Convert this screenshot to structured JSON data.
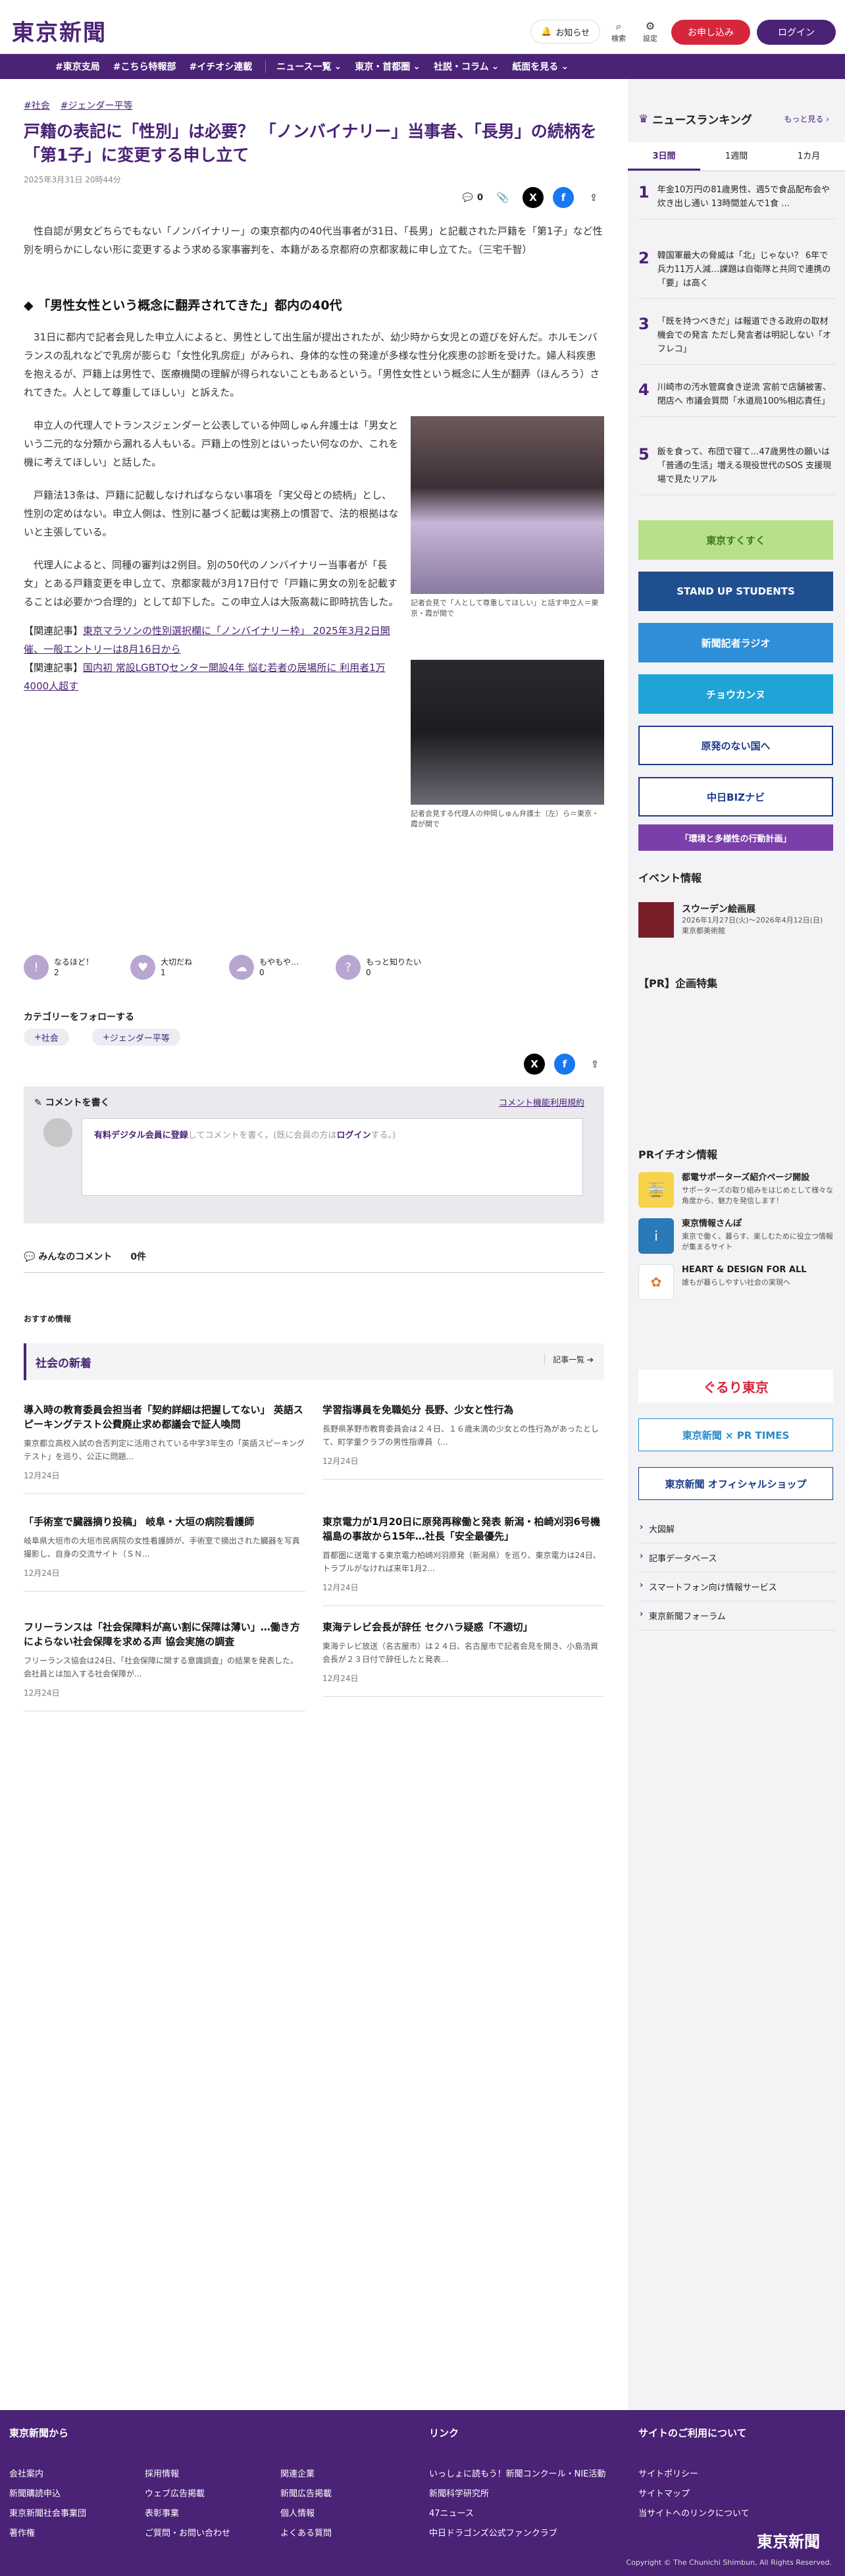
{
  "header": {
    "logo": "東京新聞",
    "notice": "お知らせ",
    "search": "検索",
    "settings": "設定",
    "apply": "お申し込み",
    "login": "ログイン"
  },
  "nav": {
    "tags": [
      "#東京支局",
      "#こちら特報部",
      "#イチオシ連載"
    ],
    "menus": [
      "ニュース一覧",
      "東京・首都圏",
      "社説・コラム",
      "紙面を見る"
    ]
  },
  "article": {
    "tags": [
      "社会",
      "ジェンダー平等"
    ],
    "title": "戸籍の表記に「性別」は必要？ 「ノンバイナリー」当事者、「長男」の続柄を「第1子」に変更する申し立て",
    "date": "2025年3月31日 20時44分",
    "comment_count": "0",
    "lead": "性自認が男女どちらでもない「ノンバイナリー」の東京都内の40代当事者が31日、「長男」と記載された戸籍を「第1子」など性別を明らかにしない形に変更するよう求める家事審判を、本籍がある京都府の京都家裁に申し立てた。（三宅千智）",
    "h2": "「男性女性という概念に翻弄されてきた」都内の40代",
    "p1": "31日に都内で記者会見した申立人によると、男性として出生届が提出されたが、幼少時から女児との遊びを好んだ。ホルモンバランスの乱れなどで乳房が膨らむ「女性化乳房症」がみられ、身体的な性の発達が多様な性分化疾患の診断を受けた。婦人科疾患を抱えるが、戸籍上は男性で、医療機関の理解が得られないこともあるという。「男性女性という概念に人生が翻弄（ほんろう）されてきた。人として尊重してほしい」と訴えた。",
    "p2": "申立人の代理人でトランスジェンダーと公表している仲岡しゅん弁護士は「男女という二元的な分類から漏れる人もいる。戸籍上の性別とはいったい何なのか、これを機に考えてほしい」と話した。",
    "p3": "戸籍法13条は、戸籍に記載しなければならない事項を「実父母との続柄」とし、性別の定めはない。申立人側は、性別に基づく記載は実務上の慣習で、法的根拠はないと主張している。",
    "p4": "代理人によると、同種の審判は2例目。別の50代のノンバイナリー当事者が「長女」とある戸籍変更を申し立て、京都家裁が3月17日付で「戸籍に男女の別を記載することは必要かつ合理的」として却下した。この申立人は大阪高裁に即時抗告した。",
    "related": [
      {
        "label": "【関連記事】",
        "link": "東京マラソンの性別選択欄に「ノンバイナリー枠」 2025年3月2日開催、一般エントリーは8月16日から"
      },
      {
        "label": "【関連記事】",
        "link": "国内初 常設LGBTQセンター開設4年 悩む若者の居場所に 利用者1万4000人超す"
      }
    ],
    "cap1": "記者会見で「人として尊重してほしい」と話す申立人＝東京・霞が関で",
    "cap2": "記者会見する代理人の仲岡しゅん弁護士（左）ら＝東京・霞が関で"
  },
  "reactions": [
    {
      "label": "なるほど！",
      "count": "2",
      "icon": "exclaim-icon"
    },
    {
      "label": "大切だね",
      "count": "1",
      "icon": "heart-icon"
    },
    {
      "label": "もやもや…",
      "count": "0",
      "icon": "cloud-icon"
    },
    {
      "label": "もっと知りたい",
      "count": "0",
      "icon": "question-icon"
    }
  ],
  "follow": {
    "title": "カテゴリーをフォローする",
    "items": [
      "社会",
      "ジェンダー平等"
    ]
  },
  "comment": {
    "heading": "コメントを書く",
    "rules": "コメント機能利用規約",
    "register": "有料デジタル会員に登録",
    "middle": "してコメントを書く。(既に会員の方は",
    "login": "ログイン",
    "tail": "する。)"
  },
  "comments": {
    "label": "みんなのコメント",
    "count": "0件"
  },
  "recommend": "おすすめ情報",
  "section": {
    "title": "社会の新着",
    "more": "記事一覧"
  },
  "news": [
    {
      "title": "導入時の教育委員会担当者「契約詳細は把握してない」 英語スピーキングテスト公費廃止求め都議会で証人喚問",
      "body": "東京都立高校入試の合否判定に活用されている中学3年生の「英語スピーキングテスト」を巡り、公正に問題...",
      "date": "12月24日"
    },
    {
      "title": "学習指導員を免職処分 長野、少女と性行為",
      "body": "長野県茅野市教育委員会は２４日、１６歳未満の少女との性行為があったとして、町学童クラブの男性指導員（...",
      "date": "12月24日"
    },
    {
      "title": "「手術室で臓器摘り投稿」 岐阜・大垣の病院看護師",
      "body": "岐阜県大垣市の大垣市民病院の女性看護師が、手術室で摘出された臓器を写真撮影し、自身の交流サイト（ＳＮ...",
      "date": "12月24日"
    },
    {
      "title": "東京電力が1月20日に原発再稼働と発表 新潟・柏崎刈羽6号機 福島の事故から15年…社長「安全最優先」",
      "body": "首都圏に送電する東京電力柏崎刈羽原発（新潟県）を巡り、東京電力は24日、トラブルがなければ来年1月2...",
      "date": "12月24日"
    },
    {
      "title": "フリーランスは「社会保障料が高い割に保障は薄い」…働き方によらない社会保障を求める声 協会実施の調査",
      "body": "フリーランス協会は24日、「社会保障に関する意識調査」の結果を発表した。会社員とは加入する社会保障が...",
      "date": "12月24日"
    },
    {
      "title": "東海テレビ会長が辞任 セクハラ疑惑「不適切」",
      "body": "東海テレビ放送（名古屋市）は２４日、名古屋市で記者会見を開き、小島浩資会長が２３日付で辞任したと発表...",
      "date": "12月24日"
    }
  ],
  "ranking": {
    "title": "ニュースランキング",
    "more": "もっと見る",
    "tabs": [
      "3日間",
      "1週間",
      "1カ月"
    ],
    "items": [
      "年金10万円の81歳男性、週5で食品配布会や炊き出し通い 13時間並んで1食 …",
      "韓国軍最大の脅威は「北」じゃない？ 6年で兵力11万人減…課題は自衛隊と共同で連携の「要」は高く",
      "「既を持つべきだ」は報道できる政府の取材機会での発言 ただし発言者は明記しない「オフレコ」",
      "川崎市の汚水管腐食き逆流 宮前で店舗被害、閉店へ 市議会質問「水道局100%相応責任」",
      "飯を食って、布団で寝て…47歳男性の願いは「普通の生活」増える現役世代のSOS 支援現場で見たリアル"
    ]
  },
  "banners": [
    "東京すくすく",
    "STAND UP STUDENTS",
    "新聞記者ラジオ",
    "チョウカンヌ",
    "原発のない国へ",
    "中日BIZナビ",
    "「環境と多様性の行動計画」"
  ],
  "event": {
    "title": "イベント情報",
    "name": "スウーデン絵画展",
    "date": "2026年1月27日(火)～2026年4月12日(日) 東京都美術館"
  },
  "pr_title": "【PR】企画特集",
  "prpick": {
    "title": "PRイチオシ情報",
    "items": [
      {
        "title": "都電サポーターズ紹介ページ開設",
        "desc": "サポーターズの取り組みをはじめとして様々な角度から、魅力を発信します！"
      },
      {
        "title": "東京情報さんぽ",
        "desc": "東京で働く、暮らす、楽しむために役立つ情報が集まるサイト"
      },
      {
        "title": "HEART & DESIGN FOR ALL",
        "desc": "誰もが暮らしやすい社会の実現へ"
      }
    ]
  },
  "side_banners": [
    "ぐるり東京",
    "東京新聞 × PR TIMES",
    "東京新聞 オフィシャルショップ"
  ],
  "links": [
    "大図解",
    "記事データベース",
    "スマートフォン向け情報サービス",
    "東京新聞フォーラム"
  ],
  "footer": {
    "h1": "東京新聞から",
    "h2": "リンク",
    "h3": "サイトのご利用について",
    "c1": [
      "会社案内",
      "新聞購読申込",
      "東京新聞社会事業団",
      "著作権"
    ],
    "c2": [
      "採用情報",
      "ウェブ広告掲載",
      "表彰事業",
      "ご質問・お問い合わせ"
    ],
    "c3": [
      "関連企業",
      "新聞広告掲載",
      "個人情報",
      "よくある質問"
    ],
    "c4": [
      "いっしょに読もう！新聞コンクール・NIE活動",
      "新聞科学研究所",
      "47ニュース",
      "中日ドラゴンズ公式ファンクラブ"
    ],
    "c5": [
      "サイトポリシー",
      "サイトマップ",
      "当サイトへのリンクについて"
    ],
    "logo": "東京新聞",
    "copyright": "Copyright © The Chunichi Shimbun, All Rights Reserved."
  },
  "colors": {
    "brand": "#4a2276",
    "accent": "#d6263b"
  }
}
